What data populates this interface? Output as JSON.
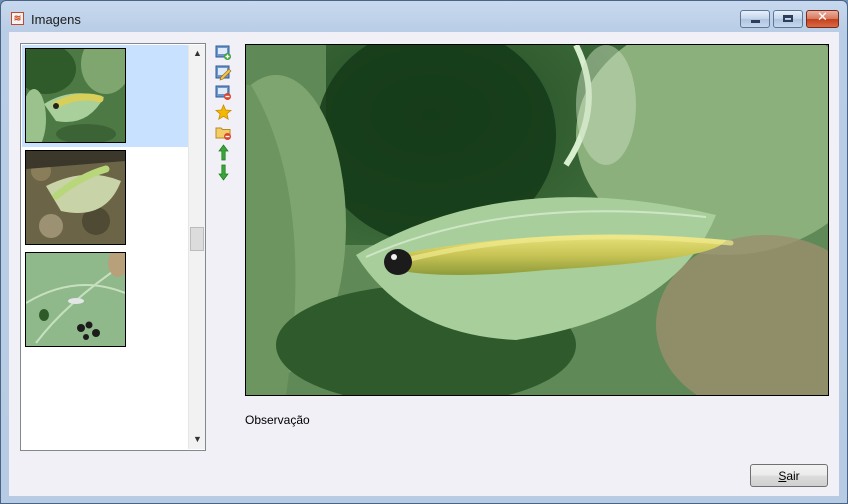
{
  "window": {
    "title": "Imagens",
    "app_icon": "app-logo-icon",
    "controls": [
      "minimize-icon",
      "maximize-icon",
      "close-icon"
    ]
  },
  "thumbnails": {
    "items": [
      {
        "subject": "caterpillar on leaf",
        "selected": true
      },
      {
        "subject": "caterpillar on ground leaf",
        "selected": false
      },
      {
        "subject": "leaf with insects",
        "selected": false
      }
    ]
  },
  "toolbar": {
    "icons": [
      "add-image-icon",
      "edit-image-icon",
      "remove-image-icon",
      "star-icon",
      "remove-folder-icon",
      "arrow-up-icon",
      "arrow-down-icon"
    ]
  },
  "main": {
    "observation_label": "Observação"
  },
  "footer": {
    "exit_button_access_key": "S",
    "exit_button_rest": "air"
  },
  "colors": {
    "selection": "#c8e1ff",
    "client_bg": "#f0f0f6",
    "star": "#f5b800",
    "arrow": "#3aa53a"
  }
}
